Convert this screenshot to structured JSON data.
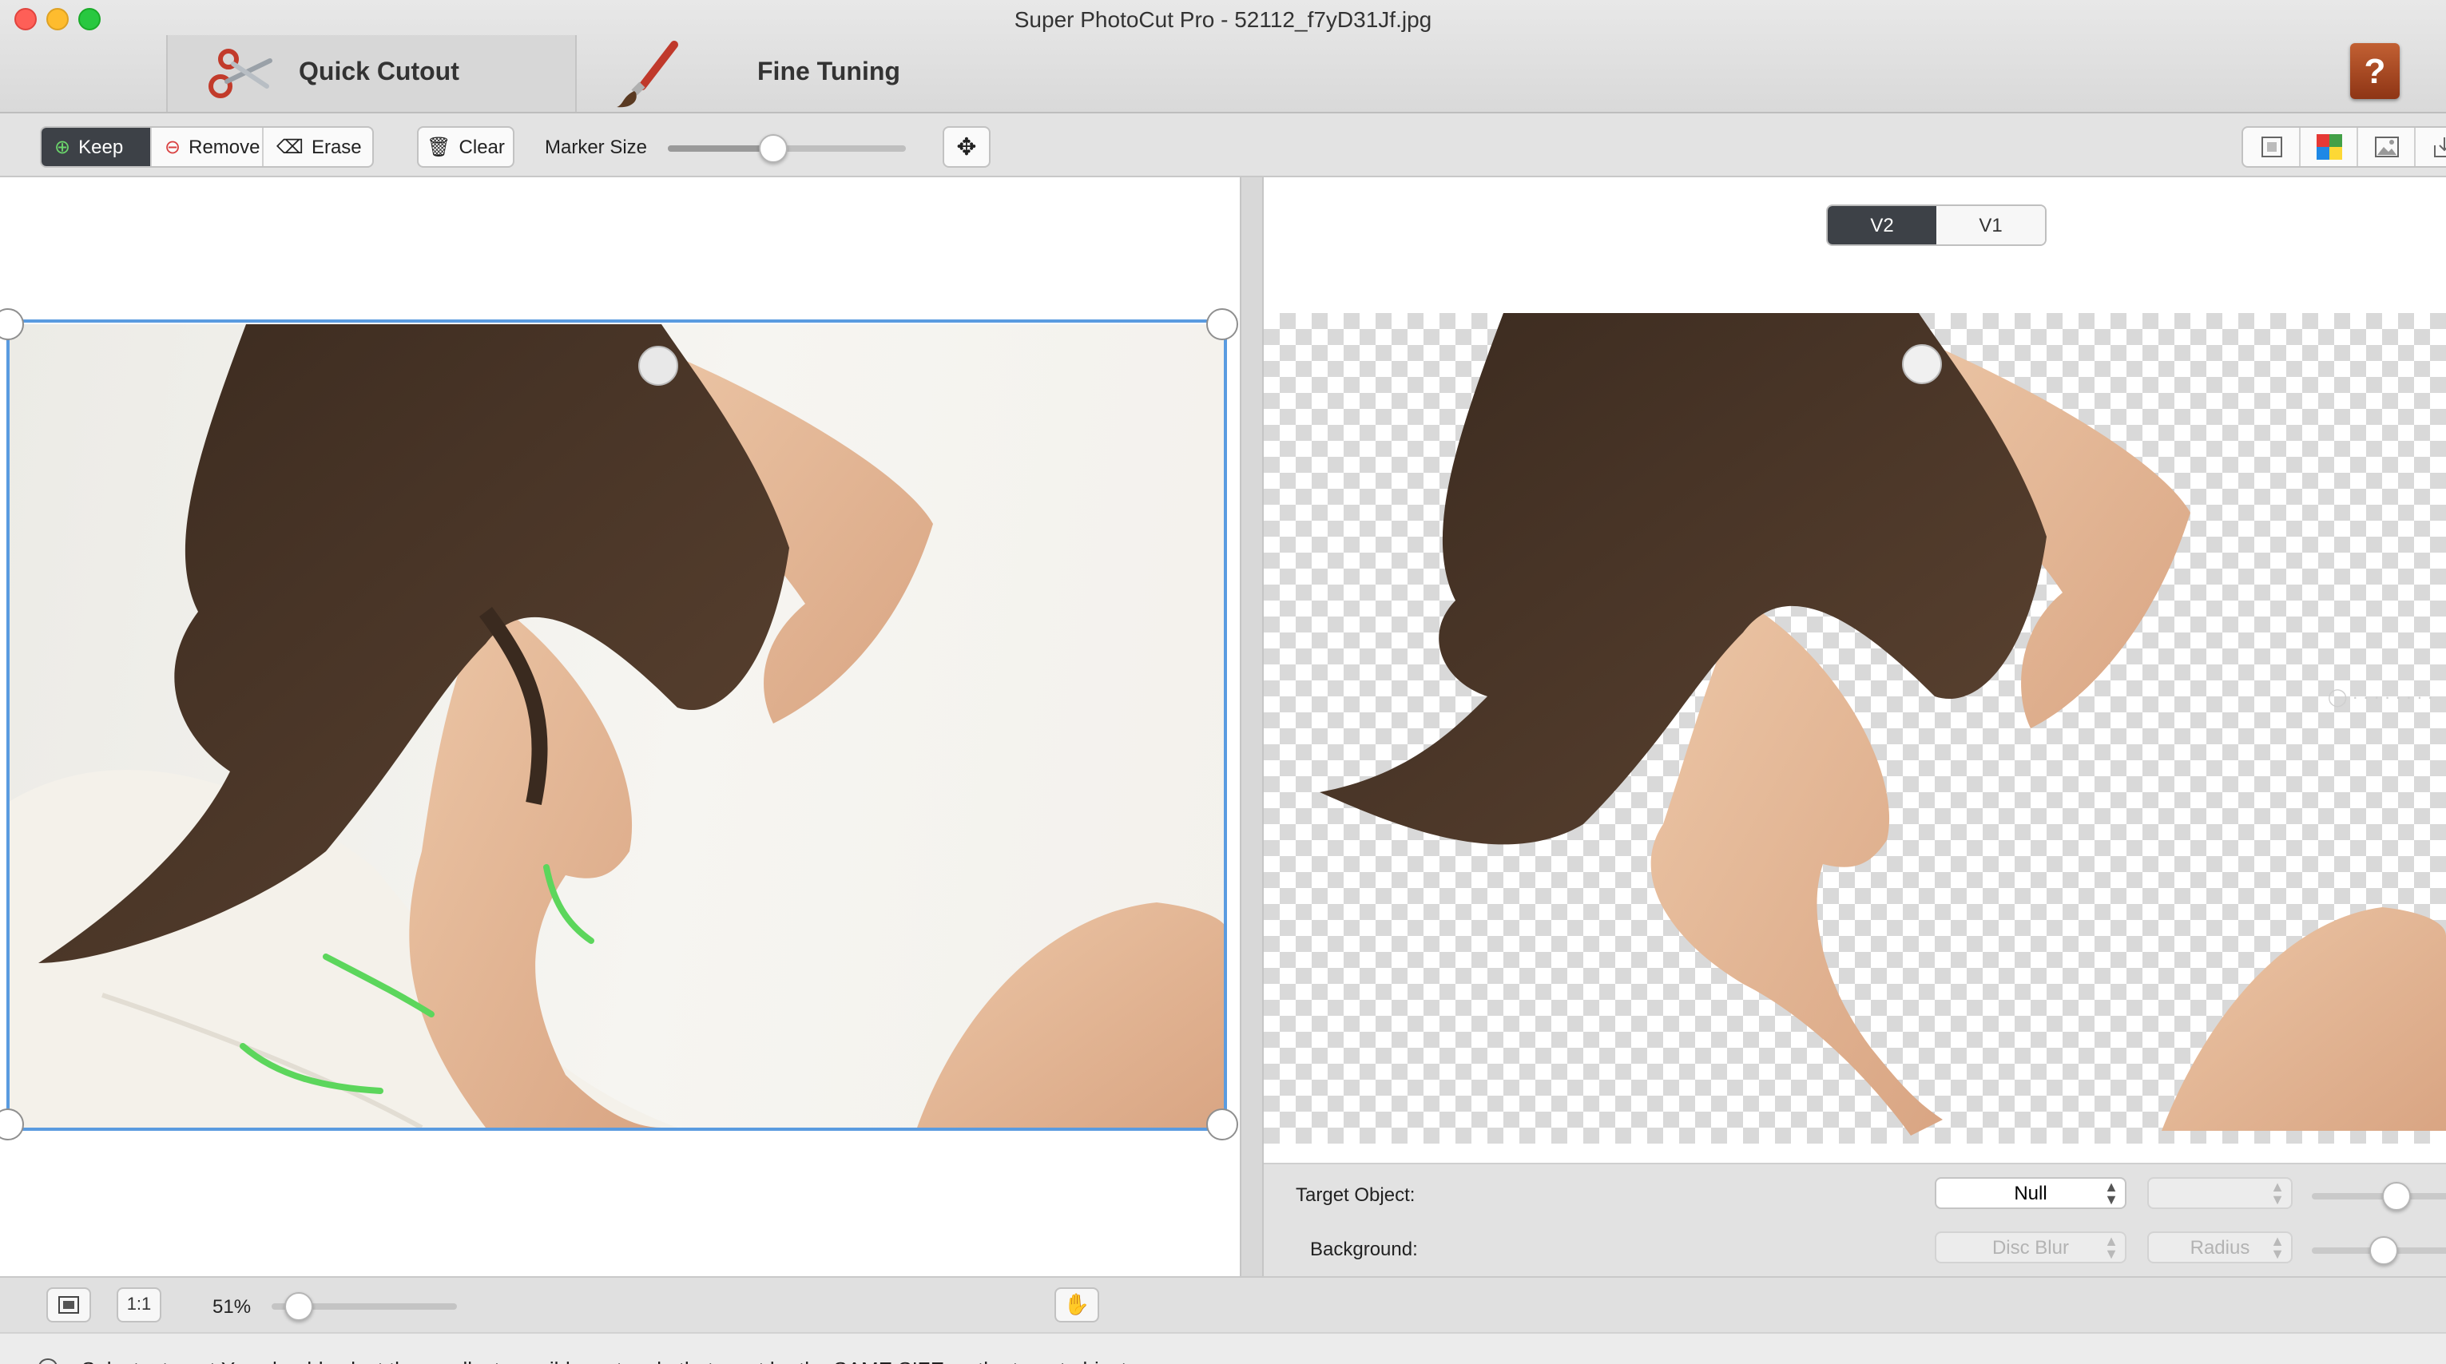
{
  "window": {
    "title": "Super PhotoCut Pro - 52112_f7yD31Jf.jpg"
  },
  "mode_tabs": [
    {
      "label": "Quick Cutout",
      "active": true,
      "icon": "scissors-icon"
    },
    {
      "label": "Fine Tuning",
      "active": false,
      "icon": "paintbrush-icon"
    }
  ],
  "toolbar": {
    "mark_modes": [
      {
        "label": "Keep",
        "icon": "plus-circle-icon",
        "selected": true
      },
      {
        "label": "Remove",
        "icon": "minus-circle-icon",
        "selected": false
      },
      {
        "label": "Erase",
        "icon": "eraser-icon",
        "selected": false
      }
    ],
    "clear_label": "Clear",
    "marker_size_label": "Marker Size",
    "marker_size_value": 0.44,
    "move_icon": "move-arrows-icon",
    "right_tools": [
      "fit-view-icon",
      "color-palette-icon",
      "image-icon",
      "export-icon"
    ]
  },
  "preview": {
    "versions": [
      {
        "label": "V2",
        "selected": true
      },
      {
        "label": "V1",
        "selected": false
      }
    ],
    "target_object_label": "Target Object:",
    "target_object_value": "Null",
    "target_secondary_value": "",
    "target_slider_value": 0.5,
    "background_label": "Background:",
    "background_value": "Disc Blur",
    "background_secondary_value": "Radius",
    "background_slider_value": 0.42
  },
  "bottom": {
    "fit_icon": "fit-screen-icon",
    "actual_size_label": "1:1",
    "zoom_label": "51%",
    "zoom_value": 0.1,
    "hand_icon": "hand-tool-icon"
  },
  "status": {
    "icon": "lightbulb-icon",
    "text": "Select a target:You should select the smallest possible rectangle that must be the SAME SIZE as the target object."
  },
  "colors": {
    "accent_dark": "#3d4147",
    "selection_blue": "#5a9be0",
    "marker_green": "#5cd65c"
  }
}
